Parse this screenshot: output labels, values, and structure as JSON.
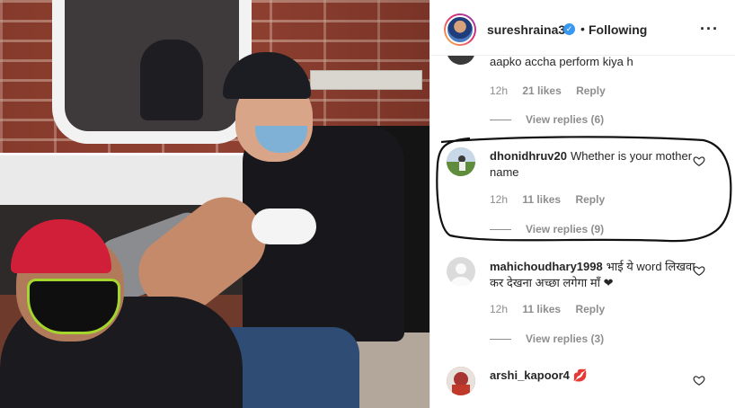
{
  "post": {
    "username": "sureshraina3",
    "separator": "•",
    "follow_status": "Following",
    "more_icon": "more-horizontal-icon",
    "verified_icon": "verified-badge-icon"
  },
  "comments": [
    {
      "text": "aapko accha perform kiya h",
      "time": "12h",
      "likes": "21 likes",
      "reply": "Reply",
      "view_replies": "View replies (6)"
    },
    {
      "username": "dhonidhruv20",
      "text": "Whether is your mother name",
      "time": "12h",
      "likes": "11 likes",
      "reply": "Reply",
      "view_replies": "View replies (9)"
    },
    {
      "username": "mahichoudhary1998",
      "text": "भाई ये word लिखवा कर देखना अच्छा लगेगा माँ ❤",
      "time": "12h",
      "likes": "11 likes",
      "reply": "Reply",
      "view_replies": "View replies (3)"
    },
    {
      "username": "arshi_kapoor4",
      "text": "💋"
    }
  ],
  "colors": {
    "accent": "#3897f0",
    "muted": "#8e8e8e",
    "text": "#262626"
  }
}
